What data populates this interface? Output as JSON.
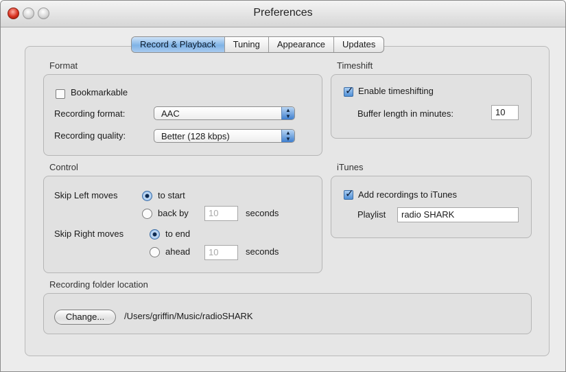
{
  "window": {
    "title": "Preferences"
  },
  "tabs": [
    "Record & Playback",
    "Tuning",
    "Appearance",
    "Updates"
  ],
  "active_tab": "Record & Playback",
  "format": {
    "section_label": "Format",
    "bookmarkable_label": "Bookmarkable",
    "bookmarkable_checked": false,
    "recording_format_label": "Recording format:",
    "recording_format_value": "AAC",
    "recording_quality_label": "Recording quality:",
    "recording_quality_value": "Better (128 kbps)"
  },
  "timeshift": {
    "section_label": "Timeshift",
    "enable_label": "Enable timeshifting",
    "enable_checked": true,
    "buffer_label": "Buffer length in minutes:",
    "buffer_value": "10"
  },
  "control": {
    "section_label": "Control",
    "skip_left_label": "Skip Left moves",
    "to_start_label": "to start",
    "back_by_label": "back by",
    "back_by_value": "10",
    "seconds_label": "seconds",
    "skip_right_label": "Skip Right moves",
    "to_end_label": "to end",
    "ahead_label": "ahead",
    "ahead_value": "10",
    "seconds_label_2": "seconds"
  },
  "itunes": {
    "section_label": "iTunes",
    "add_label": "Add recordings to iTunes",
    "add_checked": true,
    "playlist_label": "Playlist",
    "playlist_value": "radio SHARK"
  },
  "folder": {
    "section_label": "Recording folder location",
    "change_button": "Change...",
    "path": "/Users/griffin/Music/radioSHARK"
  },
  "colors": {
    "accent": "#7fb3e6",
    "close_button": "#d8301f"
  }
}
